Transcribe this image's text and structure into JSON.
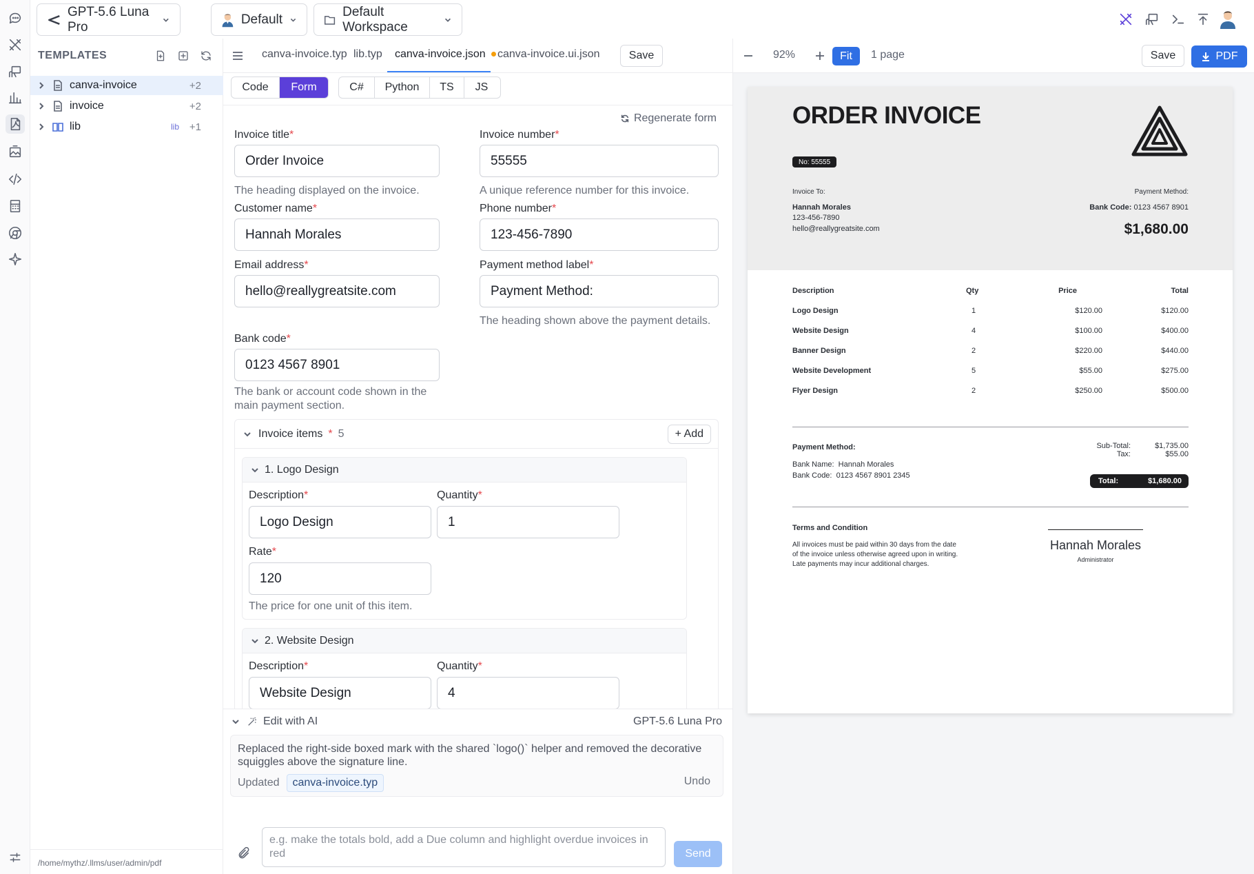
{
  "topbar": {
    "model_label": "GPT-5.6 Luna Pro",
    "persona_label": "Default",
    "workspace_label": "Default Workspace"
  },
  "rail": {
    "icons": [
      "chat-icon",
      "tools-icon",
      "presenter-icon",
      "chart-icon",
      "pdf-icon",
      "image-icon",
      "code-icon",
      "calculator-icon",
      "chrome-icon",
      "sparkle-icon",
      "settings-sliders-icon"
    ]
  },
  "sidebar": {
    "title": "TEMPLATES",
    "items": [
      {
        "label": "canva-invoice",
        "badge": "+2",
        "selected": true
      },
      {
        "label": "invoice",
        "badge": "+2",
        "selected": false
      },
      {
        "label": "lib",
        "tag": "lib",
        "badge": "+1",
        "selected": false
      }
    ],
    "footer_path": "/home/mythz/.llms/user/admin/pdf"
  },
  "editor": {
    "tabs": [
      "canva-invoice.typ",
      "lib.typ",
      "canva-invoice.json",
      "canva-invoice.ui.json"
    ],
    "active_tab": "canva-invoice.json",
    "save_label": "Save",
    "segments_mode": [
      "Code",
      "Form"
    ],
    "segments_lang": [
      "C#",
      "Python",
      "TS",
      "JS"
    ],
    "regen_label": "Regenerate form",
    "fields": {
      "invoice_title": {
        "label": "Invoice title",
        "value": "Order Invoice",
        "help": "The heading displayed on the invoice."
      },
      "invoice_number": {
        "label": "Invoice number",
        "value": "55555",
        "help": "A unique reference number for this invoice."
      },
      "customer_name": {
        "label": "Customer name",
        "value": "Hannah Morales"
      },
      "phone_number": {
        "label": "Phone number",
        "value": "123-456-7890"
      },
      "email": {
        "label": "Email address",
        "value": "hello@reallygreatsite.com"
      },
      "payment_label": {
        "label": "Payment method label",
        "value": "Payment Method:",
        "help": "The heading shown above the payment details."
      },
      "bank_code": {
        "label": "Bank code",
        "value": "0123 4567 8901",
        "help": "The bank or account code shown in the main payment section."
      }
    },
    "items_group": {
      "label": "Invoice items",
      "count": "5",
      "add_label": "+ Add"
    },
    "items": [
      {
        "head": "1. Logo Design",
        "desc_label": "Description",
        "desc": "Logo Design",
        "qty_label": "Quantity",
        "qty": "1",
        "rate_label": "Rate",
        "rate": "120",
        "rate_help": "The price for one unit of this item."
      },
      {
        "head": "2. Website Design",
        "desc_label": "Description",
        "desc": "Website Design",
        "qty_label": "Quantity",
        "qty": "4"
      }
    ],
    "ai": {
      "title": "Edit with AI",
      "model": "GPT-5.6 Luna Pro",
      "message": "Replaced the right-side boxed mark with the shared `logo()` helper and removed the decorative squiggles above the signature line.",
      "updated_label": "Updated",
      "updated_file": "canva-invoice.typ",
      "undo_label": "Undo",
      "prompt_placeholder": "e.g. make the totals bold, add a Due column and highlight overdue invoices in red",
      "send_label": "Send"
    }
  },
  "preview": {
    "zoom": "92%",
    "fit_label": "Fit",
    "pages": "1 page",
    "save_label": "Save",
    "pdf_label": "PDF",
    "invoice": {
      "title": "ORDER INVOICE",
      "no_badge": "No: 55555",
      "to_label": "Invoice To:",
      "customer": "Hannah Morales",
      "phone": "123-456-7890",
      "email": "hello@reallygreatsite.com",
      "pm_label": "Payment Method:",
      "bank_code_label": "Bank Code:",
      "bank_code": "0123 4567 8901",
      "amount": "$1,680.00",
      "columns": [
        "Description",
        "Qty",
        "Price",
        "Total"
      ],
      "rows": [
        {
          "desc": "Logo Design",
          "qty": "1",
          "price": "$120.00",
          "total": "$120.00"
        },
        {
          "desc": "Website Design",
          "qty": "4",
          "price": "$100.00",
          "total": "$400.00"
        },
        {
          "desc": "Banner Design",
          "qty": "2",
          "price": "$220.00",
          "total": "$440.00"
        },
        {
          "desc": "Website Development",
          "qty": "5",
          "price": "$55.00",
          "total": "$275.00"
        },
        {
          "desc": "Flyer Design",
          "qty": "2",
          "price": "$250.00",
          "total": "$500.00"
        }
      ],
      "payment_method": "Payment Method:",
      "bank_name_label": "Bank Name:",
      "bank_name": "Hannah Morales",
      "bank_code2_label": "Bank Code:",
      "bank_code2": "0123 4567 8901 2345",
      "subtotal_label": "Sub-Total:",
      "subtotal": "$1,735.00",
      "tax_label": "Tax:",
      "tax": "$55.00",
      "total_label": "Total:",
      "total": "$1,680.00",
      "terms_title": "Terms and Condition",
      "terms_l1": "All invoices must be paid within 30 days from the date",
      "terms_l2": "of the invoice unless otherwise agreed upon in writing.",
      "terms_l3": "Late payments may incur additional charges.",
      "sig_name": "Hannah Morales",
      "sig_role": "Administrator"
    }
  }
}
